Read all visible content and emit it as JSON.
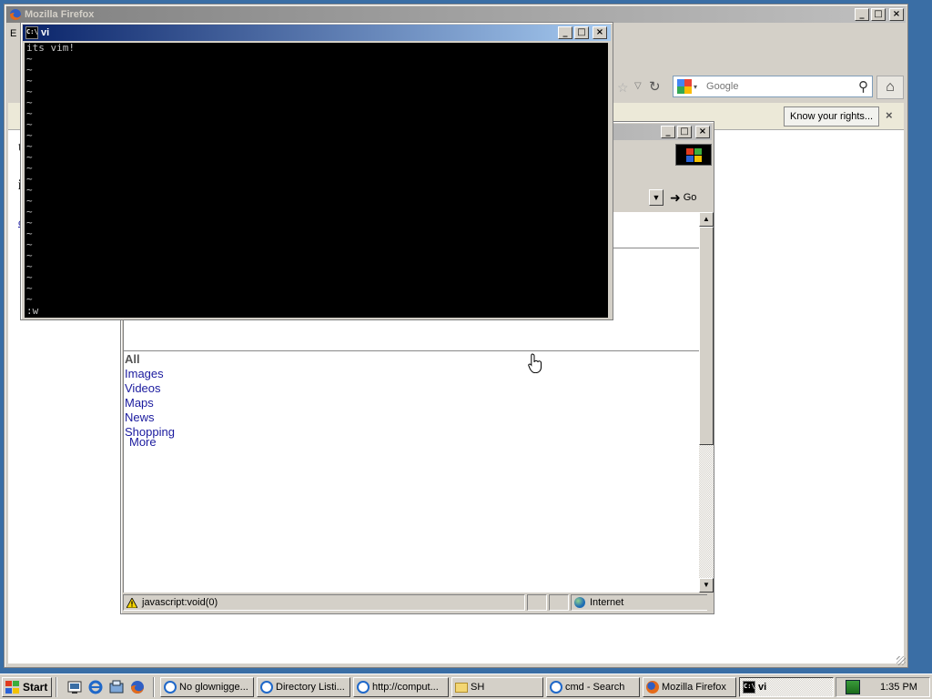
{
  "firefox": {
    "title": "Mozilla Firefox",
    "menu_fragment": "E",
    "search_placeholder": "Google",
    "notification_button": "Know your rights...",
    "content_fragments": [
      "t",
      "i",
      "c"
    ]
  },
  "vi": {
    "title": "vi",
    "lines": [
      "its vim!",
      "~",
      "~",
      "~",
      "~",
      "~",
      "~",
      "~",
      "~",
      "~",
      "~",
      "~",
      "~",
      "~",
      "~",
      "~",
      "~",
      "~",
      "~",
      "~",
      "~",
      "~",
      "~",
      "~"
    ],
    "command_line": ":w"
  },
  "ie": {
    "go_label": "Go",
    "nav_links": [
      "All",
      "Images",
      "Videos",
      "Maps",
      "News",
      "Shopping"
    ],
    "more_label": "More",
    "status_text": "javascript:void(0)",
    "zone_text": "Internet"
  },
  "taskbar": {
    "start_label": "Start",
    "buttons": [
      {
        "label": "No glownigge...",
        "icon": "ie-icon"
      },
      {
        "label": "Directory Listi...",
        "icon": "ie-icon"
      },
      {
        "label": "http://comput...",
        "icon": "ie-icon"
      },
      {
        "label": "SH",
        "icon": "folder-icon"
      },
      {
        "label": "cmd - Search",
        "icon": "ie-icon"
      },
      {
        "label": "Mozilla Firefox",
        "icon": "firefox-icon"
      },
      {
        "label": "vi",
        "icon": "cmd-icon"
      }
    ],
    "clock": "1:35 PM"
  },
  "colors": {
    "desktop": "#3a6ea5",
    "active_title": "#0a246a",
    "inactive_title": "#808080",
    "link": "#1a1a9e"
  }
}
